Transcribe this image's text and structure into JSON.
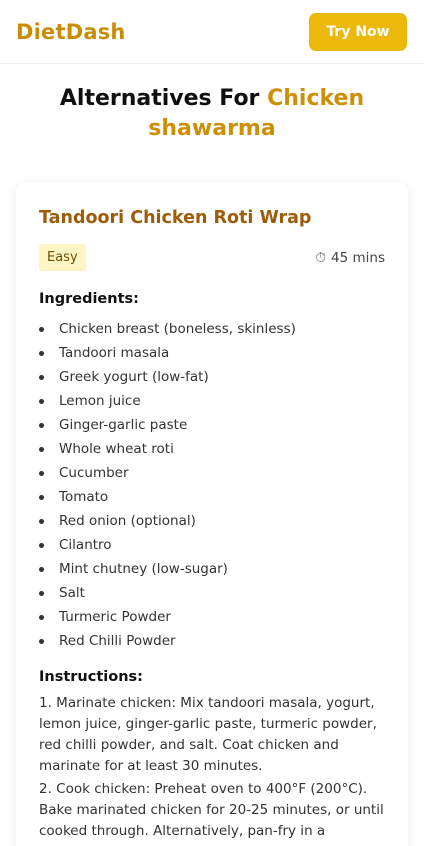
{
  "header": {
    "brand": "DietDash",
    "cta_label": "Try Now"
  },
  "page": {
    "title_prefix": "Alternatives For",
    "title_highlight": "Chicken shawarma"
  },
  "colors": {
    "brand": "#c98d05",
    "cta_bg": "#ecb80a",
    "card_title": "#9c5c08",
    "badge_bg": "#fdf6c4"
  },
  "recipe": {
    "title": "Tandoori Chicken Roti Wrap",
    "difficulty": "Easy",
    "time": "45 mins",
    "time_icon": "stopwatch-icon",
    "ingredients_heading": "Ingredients:",
    "ingredients": [
      "Chicken breast (boneless, skinless)",
      "Tandoori masala",
      "Greek yogurt (low-fat)",
      "Lemon juice",
      "Ginger-garlic paste",
      "Whole wheat roti",
      "Cucumber",
      "Tomato",
      "Red onion (optional)",
      "Cilantro",
      "Mint chutney (low-sugar)",
      "Salt",
      "Turmeric Powder",
      "Red Chilli Powder"
    ],
    "instructions_heading": "Instructions:",
    "instructions": [
      "1. Marinate chicken: Mix tandoori masala, yogurt, lemon juice, ginger-garlic paste, turmeric powder, red chilli powder, and salt. Coat chicken and marinate for at least 30 minutes.",
      "2. Cook chicken: Preheat oven to 400°F (200°C). Bake marinated chicken for 20-25 minutes, or until cooked through. Alternatively, pan-fry in a"
    ]
  }
}
